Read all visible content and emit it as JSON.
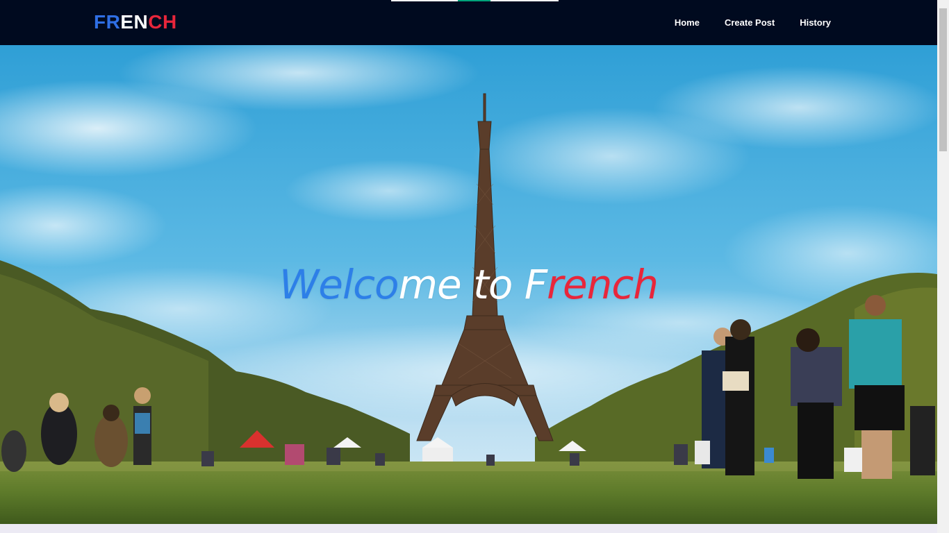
{
  "brand": {
    "letters": [
      {
        "text": "FR",
        "color": "#2f6fe4"
      },
      {
        "text": "EN",
        "color": "#ffffff"
      },
      {
        "text": "CH",
        "color": "#e8263b"
      }
    ]
  },
  "nav": {
    "items": [
      {
        "label": "Home"
      },
      {
        "label": "Create Post"
      },
      {
        "label": "History"
      }
    ]
  },
  "hero": {
    "title_parts": [
      {
        "text": "Welco",
        "color": "#2d7fe8"
      },
      {
        "text": "me to F",
        "color": "#ffffff"
      },
      {
        "text": "rench",
        "color": "#e8263b"
      }
    ],
    "image_subject": "eiffel-tower-champ-de-mars-photo"
  },
  "colors": {
    "navbar_bg": "#000a1f",
    "accent_green": "#00a37a"
  }
}
